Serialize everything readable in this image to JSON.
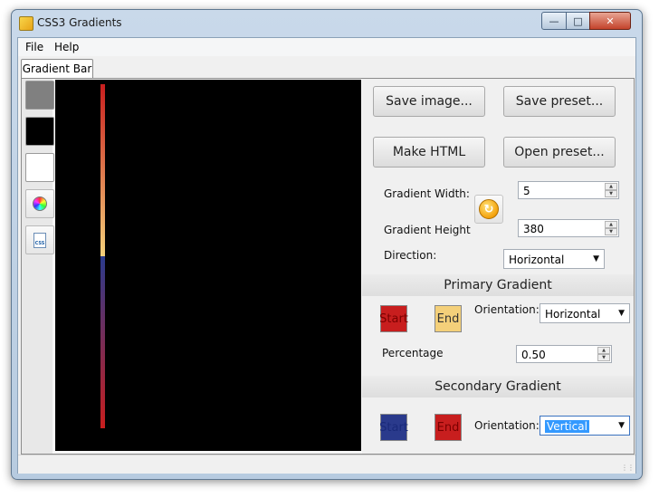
{
  "window": {
    "title": "CSS3 Gradients"
  },
  "menu": {
    "file": "File",
    "help": "Help"
  },
  "tabs": [
    {
      "label": "Gradient Bar"
    }
  ],
  "toolbar": {
    "swatches": [
      "#808080",
      "#000000",
      "#ffffff"
    ],
    "icons": [
      "color-wheel-icon",
      "css-file-icon"
    ]
  },
  "preview": {
    "background": "#000000",
    "gradient_colors": [
      "#c81e1e",
      "#f4d07a",
      "#2a3a8c",
      "#c81e1e"
    ]
  },
  "buttons": {
    "save_image": "Save image...",
    "save_preset": "Save preset...",
    "make_html": "Make HTML",
    "open_preset": "Open preset..."
  },
  "settings": {
    "width_label": "Gradient Width:",
    "width_value": "5",
    "height_label": "Gradient Height",
    "height_value": "380",
    "direction_label": "Direction:",
    "direction_value": "Horizontal"
  },
  "primary": {
    "title": "Primary Gradient",
    "start_label": "Start",
    "start_color": "#c81e1e",
    "end_label": "End",
    "end_color": "#f4d07a",
    "orientation_label": "Orientation:",
    "orientation_value": "Horizontal",
    "percentage_label": "Percentage",
    "percentage_value": "0.50"
  },
  "secondary": {
    "title": "Secondary Gradient",
    "start_label": "Start",
    "start_color": "#2a3a8c",
    "end_label": "End",
    "end_color": "#c81e1e",
    "orientation_label": "Orientation:",
    "orientation_value": "Vertical"
  }
}
